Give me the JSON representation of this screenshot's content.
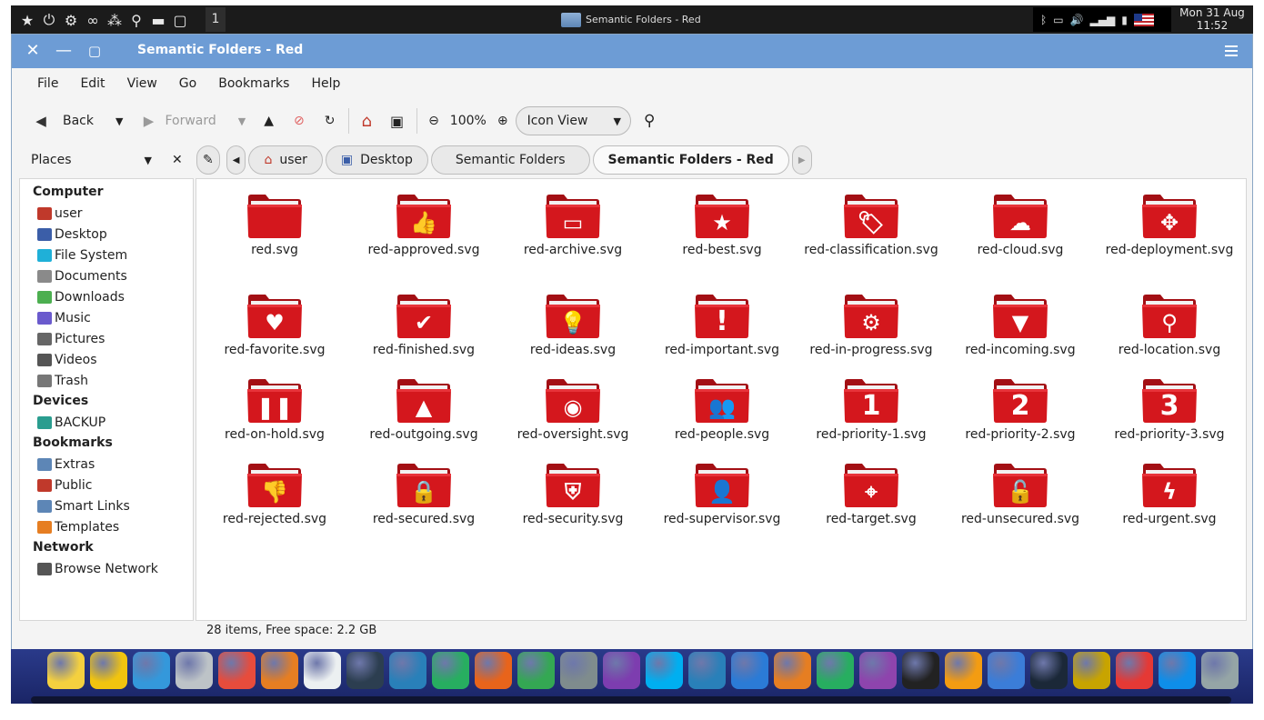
{
  "top_panel": {
    "launchers": [
      "star-icon",
      "power-icon",
      "toggle-icon",
      "binoculars-icon",
      "grid-icon",
      "search-icon",
      "folder-icon",
      "window-icon"
    ],
    "workspace": "1",
    "task_title": "Semantic Folders - Red",
    "clock_date": "Mon 31 Aug",
    "clock_time": "11:52"
  },
  "window": {
    "title": "Semantic Folders - Red"
  },
  "menu": [
    "File",
    "Edit",
    "View",
    "Go",
    "Bookmarks",
    "Help"
  ],
  "toolbar": {
    "back": "Back",
    "forward": "Forward",
    "zoom": "100%",
    "view_mode": "Icon View"
  },
  "places": {
    "header": "Places",
    "groups": [
      {
        "title": "Computer",
        "items": [
          {
            "label": "user",
            "color": "#c0392b"
          },
          {
            "label": "Desktop",
            "color": "#3b5ea8"
          },
          {
            "label": "File System",
            "color": "#1fb0d8"
          },
          {
            "label": "Documents",
            "color": "#8a8a8a"
          },
          {
            "label": "Downloads",
            "color": "#4caf50"
          },
          {
            "label": "Music",
            "color": "#6a5acd"
          },
          {
            "label": "Pictures",
            "color": "#666666"
          },
          {
            "label": "Videos",
            "color": "#555555"
          },
          {
            "label": "Trash",
            "color": "#777777"
          }
        ]
      },
      {
        "title": "Devices",
        "items": [
          {
            "label": "BACKUP",
            "color": "#2a9d8f"
          }
        ]
      },
      {
        "title": "Bookmarks",
        "items": [
          {
            "label": "Extras",
            "color": "#5d86b6"
          },
          {
            "label": "Public",
            "color": "#c0392b"
          },
          {
            "label": "Smart Links",
            "color": "#5d86b6"
          },
          {
            "label": "Templates",
            "color": "#e67e22"
          }
        ]
      },
      {
        "title": "Network",
        "items": [
          {
            "label": "Browse Network",
            "color": "#555555"
          }
        ]
      }
    ]
  },
  "path": [
    "user",
    "Desktop",
    "Semantic Folders",
    "Semantic Folders - Red"
  ],
  "files": [
    {
      "name": "red.svg",
      "glyph": ""
    },
    {
      "name": "red-approved.svg",
      "glyph": "👍"
    },
    {
      "name": "red-archive.svg",
      "glyph": "▭"
    },
    {
      "name": "red-best.svg",
      "glyph": "★"
    },
    {
      "name": "red-classification.svg",
      "glyph": "🏷"
    },
    {
      "name": "red-cloud.svg",
      "glyph": "☁"
    },
    {
      "name": "red-deployment.svg",
      "glyph": "✥"
    },
    {
      "name": "red-favorite.svg",
      "glyph": "♥"
    },
    {
      "name": "red-finished.svg",
      "glyph": "✔"
    },
    {
      "name": "red-ideas.svg",
      "glyph": "💡"
    },
    {
      "name": "red-important.svg",
      "glyph": "!"
    },
    {
      "name": "red-in-progress.svg",
      "glyph": "⚙"
    },
    {
      "name": "red-incoming.svg",
      "glyph": "▼"
    },
    {
      "name": "red-location.svg",
      "glyph": "⚲"
    },
    {
      "name": "red-on-hold.svg",
      "glyph": "❚❚"
    },
    {
      "name": "red-outgoing.svg",
      "glyph": "▲"
    },
    {
      "name": "red-oversight.svg",
      "glyph": "◉"
    },
    {
      "name": "red-people.svg",
      "glyph": "👥"
    },
    {
      "name": "red-priority-1.svg",
      "glyph": "1"
    },
    {
      "name": "red-priority-2.svg",
      "glyph": "2"
    },
    {
      "name": "red-priority-3.svg",
      "glyph": "3"
    },
    {
      "name": "red-rejected.svg",
      "glyph": "👎"
    },
    {
      "name": "red-secured.svg",
      "glyph": "🔒"
    },
    {
      "name": "red-security.svg",
      "glyph": "⛨"
    },
    {
      "name": "red-supervisor.svg",
      "glyph": "👤"
    },
    {
      "name": "red-target.svg",
      "glyph": "⌖"
    },
    {
      "name": "red-unsecured.svg",
      "glyph": "🔓"
    },
    {
      "name": "red-urgent.svg",
      "glyph": "ϟ"
    }
  ],
  "status": "28 items, Free space: 2.2 GB",
  "colors": {
    "titlebar": "#6d9cd5",
    "folder": "#d4171d"
  },
  "dock": [
    {
      "name": "star-app-icon",
      "color": "#f4d03f"
    },
    {
      "name": "dots-app-icon",
      "color": "#f1c40f"
    },
    {
      "name": "window-app-icon",
      "color": "#3498db"
    },
    {
      "name": "cabinet-app-icon",
      "color": "#bdc3c7"
    },
    {
      "name": "toggle-app-icon",
      "color": "#e74c3c"
    },
    {
      "name": "palette-app-icon",
      "color": "#e67e22"
    },
    {
      "name": "store-app-icon",
      "color": "#ecf0f1"
    },
    {
      "name": "binoculars-app-icon",
      "color": "#2c3e50"
    },
    {
      "name": "jet-app-icon",
      "color": "#2980b9"
    },
    {
      "name": "pipe-app-icon",
      "color": "#27ae60"
    },
    {
      "name": "firefox-icon",
      "color": "#e8641b"
    },
    {
      "name": "chrome-icon",
      "color": "#34a853"
    },
    {
      "name": "earth-pro-icon",
      "color": "#7f8c8d"
    },
    {
      "name": "viber-icon",
      "color": "#7d3daf"
    },
    {
      "name": "skype-icon",
      "color": "#00aff0"
    },
    {
      "name": "mail-app-icon",
      "color": "#2980b9"
    },
    {
      "name": "writer-icon",
      "color": "#2b7bd6"
    },
    {
      "name": "presentation-icon",
      "color": "#e67e22"
    },
    {
      "name": "spreadsheet-icon",
      "color": "#27ae60"
    },
    {
      "name": "webcam-app-icon",
      "color": "#8e44ad"
    },
    {
      "name": "amazon-icon",
      "color": "#222222"
    },
    {
      "name": "vlc-icon",
      "color": "#f39c12"
    },
    {
      "name": "qbittorrent-icon",
      "color": "#3b7dd8"
    },
    {
      "name": "steam-icon",
      "color": "#1b2838"
    },
    {
      "name": "backup-app-icon",
      "color": "#c8a400"
    },
    {
      "name": "anydesk-icon",
      "color": "#e53935"
    },
    {
      "name": "teamviewer-icon",
      "color": "#0e8ee9"
    },
    {
      "name": "trash-dock-icon",
      "color": "#95a5a6"
    }
  ]
}
